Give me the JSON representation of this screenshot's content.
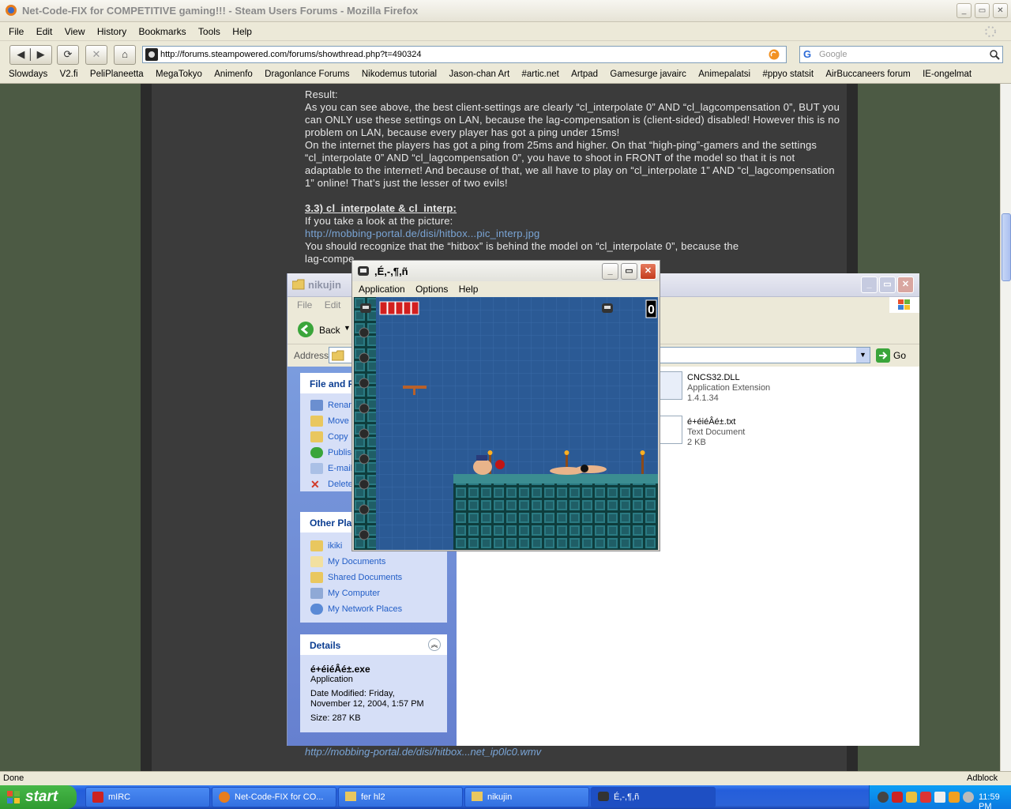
{
  "firefox": {
    "title": "Net-Code-FIX for COMPETITIVE gaming!!! - Steam Users Forums - Mozilla Firefox",
    "menu": [
      "File",
      "Edit",
      "View",
      "History",
      "Bookmarks",
      "Tools",
      "Help"
    ],
    "url": "http://forums.steampowered.com/forums/showthread.php?t=490324",
    "search_placeholder": "Google",
    "bookmarks": [
      "Slowdays",
      "V2.fi",
      "PeliPlaneetta",
      "MegaTokyo",
      "Animenfo",
      "Dragonlance Forums",
      "Nikodemus tutorial",
      "Jason-chan Art",
      "#artic.net",
      "Artpad",
      "Gamesurge javairc",
      "Animepalatsi",
      "#ppyo statsit",
      "AirBuccaneers forum",
      "IE-ongelmat"
    ],
    "status": "Done",
    "adblock": "Adblock"
  },
  "article": {
    "result_label": "Result:",
    "p1": "As you can see above, the best client-settings are clearly “cl_interpolate 0” AND “cl_lagcompensation 0”, BUT you can ONLY use these settings on LAN, because the lag-compensation is (client-sided) disabled! However this is no problem on LAN, because every player has got a ping under 15ms!",
    "p2": "On the internet the players has got a ping from 25ms and higher. On that “high-ping”-gamers and the settings “cl_interpolate 0” AND “cl_lagcompensation 0”, you have to shoot in FRONT of the model so that it is not adaptable to the internet! And because of that, we all have to play on “cl_interpolate 1” AND “cl_lagcompensation 1” online! That’s just the lesser of two evils!",
    "heading": "3.3) cl_interpolate & cl_interp:",
    "p3": "If you take a look at the picture:",
    "link1": "http://mobbing-portal.de/disi/hitbox...pic_interp.jpg",
    "p4": "You should recognize that the “hitbox” is behind the model on “cl_interpolate 0”, because the",
    "p4b": "lag-compe",
    "link2": "http://mobbing-portal.de/disi/hitbox...net_ip0lc0.wmv"
  },
  "explorer": {
    "title": "nikujin",
    "menu": [
      "File",
      "Edit"
    ],
    "back_label": "Back",
    "address_label": "Address",
    "go_label": "Go",
    "tasks_header": "File and F",
    "tasks": [
      "Renar",
      "Move",
      "Copy",
      "Publisl",
      "E-mail",
      "Delete"
    ],
    "places_header": "Other Pla",
    "places": [
      "ikiki",
      "My Documents",
      "Shared Documents",
      "My Computer",
      "My Network Places"
    ],
    "details_header": "Details",
    "details_name": "é+éiéÂé±.exe",
    "details_type": "Application",
    "details_modified": "Date Modified: Friday, November 12, 2004, 1:57 PM",
    "details_size": "Size: 287 KB",
    "files": [
      {
        "name": "CNCS32.DLL",
        "type": "Application Extension",
        "meta": "1.4.1.34"
      },
      {
        "name": "é+éiéÂé±.txt",
        "type": "Text Document",
        "meta": "2 KB"
      }
    ]
  },
  "game": {
    "title": ",É,-,¶,ñ",
    "menu": [
      "Application",
      "Options",
      "Help"
    ],
    "score": "0",
    "health_bars": 5
  },
  "taskbar": {
    "start": "start",
    "tasks": [
      "mIRC",
      "Net-Code-FIX for CO...",
      "fer hl2",
      "nikujin",
      "É,-,¶,ñ"
    ],
    "clock": "11:59 PM"
  },
  "colors": {
    "page_bg": "#4c5a44",
    "article_bg": "#3b3b3b",
    "link": "#7aa5d6",
    "xp_blue": "#245edb",
    "game_bg": "#2b5a95"
  }
}
